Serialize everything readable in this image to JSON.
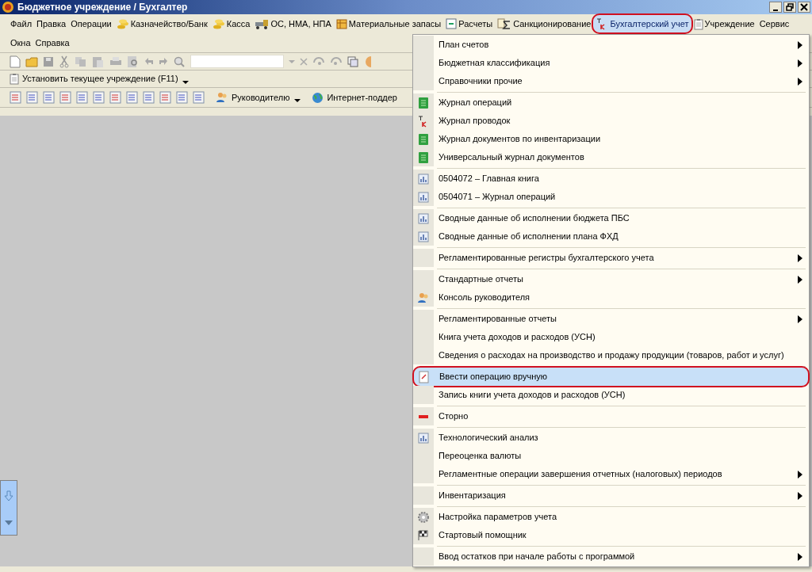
{
  "window": {
    "title": "Бюджетное учреждение / Бухгалтер"
  },
  "menu_bar": [
    {
      "label": "Файл",
      "selected": false,
      "circled": false
    },
    {
      "label": "Правка",
      "selected": false,
      "circled": false
    },
    {
      "label": "Операции",
      "selected": false,
      "circled": false
    },
    {
      "label": "Казначейство/Банк",
      "selected": false,
      "circled": false
    },
    {
      "label": "Касса",
      "selected": false,
      "circled": false
    },
    {
      "label": "ОС, НМА, НПА",
      "selected": false,
      "circled": false
    },
    {
      "label": "Материальные запасы",
      "selected": false,
      "circled": false
    },
    {
      "label": "Расчеты",
      "selected": false,
      "circled": false
    },
    {
      "label": "Санкционирование",
      "selected": false,
      "circled": false
    },
    {
      "label": "Бухгалтерский учет",
      "selected": true,
      "circled": true
    },
    {
      "label": "Учреждение",
      "selected": false,
      "circled": false
    },
    {
      "label": "Сервис",
      "selected": false,
      "circled": false
    },
    {
      "label": "Окна",
      "selected": false,
      "circled": false
    },
    {
      "label": "Справка",
      "selected": false,
      "circled": false
    }
  ],
  "toolbar_2": {
    "button": "Установить текущее учреждение (F11)"
  },
  "toolbar_3": {
    "button": "Руководителю",
    "link": "Интернет-поддер"
  },
  "menu": [
    {
      "kind": "plain",
      "label": "План счетов",
      "submenu": true,
      "selected": false,
      "circled": false
    },
    {
      "kind": "plain",
      "label": "Бюджетная классификация",
      "submenu": true,
      "selected": false,
      "circled": false
    },
    {
      "kind": "plain",
      "label": "Справочники прочие",
      "submenu": true,
      "selected": false,
      "circled": false
    },
    {
      "kind": "separator"
    },
    {
      "kind": "journal",
      "label": "Журнал операций",
      "submenu": false,
      "selected": false,
      "circled": false
    },
    {
      "kind": "dtkt",
      "label": "Журнал проводок",
      "submenu": false,
      "selected": false,
      "circled": false
    },
    {
      "kind": "journal",
      "label": "Журнал документов по инвентаризации",
      "submenu": false,
      "selected": false,
      "circled": false
    },
    {
      "kind": "journal",
      "label": "Универсальный журнал документов",
      "submenu": false,
      "selected": false,
      "circled": false
    },
    {
      "kind": "separator"
    },
    {
      "kind": "report",
      "label": "0504072  –  Главная книга",
      "submenu": false,
      "selected": false,
      "circled": false
    },
    {
      "kind": "report",
      "label": "0504071  –  Журнал операций",
      "submenu": false,
      "selected": false,
      "circled": false
    },
    {
      "kind": "separator"
    },
    {
      "kind": "report",
      "label": "Сводные данные об исполнении бюджета ПБС",
      "submenu": false,
      "selected": false,
      "circled": false
    },
    {
      "kind": "report",
      "label": "Сводные данные об исполнении плана ФХД",
      "submenu": false,
      "selected": false,
      "circled": false
    },
    {
      "kind": "separator"
    },
    {
      "kind": "plain",
      "label": "Регламентированные регистры бухгалтерского учета",
      "submenu": true,
      "selected": false,
      "circled": false
    },
    {
      "kind": "separator"
    },
    {
      "kind": "plain",
      "label": "Стандартные отчеты",
      "submenu": true,
      "selected": false,
      "circled": false
    },
    {
      "kind": "people",
      "label": "Консоль руководителя",
      "submenu": false,
      "selected": false,
      "circled": false
    },
    {
      "kind": "separator"
    },
    {
      "kind": "plain",
      "label": "Регламентированные отчеты",
      "submenu": true,
      "selected": false,
      "circled": false
    },
    {
      "kind": "plain",
      "label": "Книга учета доходов и расходов (УСН)",
      "submenu": false,
      "selected": false,
      "circled": false
    },
    {
      "kind": "plain",
      "label": "Сведения о расходах на производство и продажу продукции (товаров, работ и услуг)",
      "submenu": false,
      "selected": false,
      "circled": false
    },
    {
      "kind": "separator"
    },
    {
      "kind": "manual",
      "label": "Ввести операцию вручную",
      "submenu": false,
      "selected": true,
      "circled": true
    },
    {
      "kind": "plain",
      "label": "Запись книги учета доходов и расходов (УСН)",
      "submenu": false,
      "selected": false,
      "circled": false
    },
    {
      "kind": "separator"
    },
    {
      "kind": "minus",
      "label": "Сторно",
      "submenu": false,
      "selected": false,
      "circled": false
    },
    {
      "kind": "separator"
    },
    {
      "kind": "report",
      "label": "Технологический анализ",
      "submenu": false,
      "selected": false,
      "circled": false
    },
    {
      "kind": "plain",
      "label": "Переоценка валюты",
      "submenu": false,
      "selected": false,
      "circled": false
    },
    {
      "kind": "plain",
      "label": "Регламентные операции завершения отчетных (налоговых) периодов",
      "submenu": true,
      "selected": false,
      "circled": false
    },
    {
      "kind": "separator"
    },
    {
      "kind": "plain",
      "label": "Инвентаризация",
      "submenu": true,
      "selected": false,
      "circled": false
    },
    {
      "kind": "separator"
    },
    {
      "kind": "gear",
      "label": "Настройка параметров учета",
      "submenu": false,
      "selected": false,
      "circled": false
    },
    {
      "kind": "flag",
      "label": "Стартовый помощник",
      "submenu": false,
      "selected": false,
      "circled": false
    },
    {
      "kind": "separator"
    },
    {
      "kind": "plain",
      "label": "Ввод остатков при начале работы с программой",
      "submenu": true,
      "selected": false,
      "circled": false
    }
  ]
}
